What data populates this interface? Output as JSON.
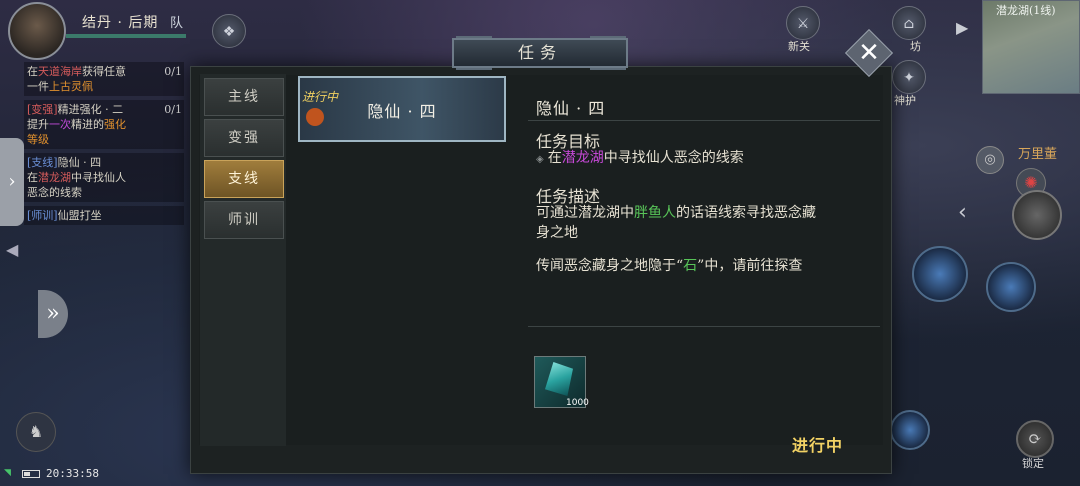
{
  "player": {
    "realm": "结丹 · 后期",
    "team": "队"
  },
  "top_icons": {
    "newbie_label": "新关",
    "workshop_label": "坊",
    "protect_label": "神护"
  },
  "minimap": {
    "title": "潜龙湖(1线)"
  },
  "tracker": {
    "entries": [
      {
        "line1_pre": "在",
        "line1_hl": "天道海岸",
        "line1_post": "获得任意",
        "line2_pre": "一件",
        "line2_hl": "上古灵佩",
        "count": "0/1"
      },
      {
        "tag": "[变强]",
        "title": "精进强化 · 二",
        "line2_pre": "提升",
        "line2_hl1": "一次",
        "line2_mid": "精进的",
        "line2_hl2": "强化",
        "line3": "等级",
        "count": "0/1"
      },
      {
        "tag": "[支线]",
        "title": "隐仙 · 四",
        "line2_pre": "在",
        "line2_hl": "潜龙湖",
        "line2_post": "中寻找仙人",
        "line3": "恶念的线索"
      },
      {
        "tag": "[师训]",
        "title": "仙盟打坐"
      }
    ]
  },
  "status_bar": {
    "time": "20:33:58"
  },
  "hud": {
    "wanli": "万里董",
    "lock": "锁定"
  },
  "dialog": {
    "title": "任务",
    "close": "✕",
    "tabs": [
      {
        "label": "主线",
        "active": false
      },
      {
        "label": "变强",
        "active": false
      },
      {
        "label": "支线",
        "active": true
      },
      {
        "label": "师训",
        "active": false
      }
    ],
    "quest_card": {
      "badge": "进行中",
      "title": "隐仙 · 四"
    },
    "detail": {
      "title": "隐仙 · 四",
      "objective_heading": "任务目标",
      "objective_pre": "在",
      "objective_hl": "潜龙湖",
      "objective_post": "中寻找仙人恶念的线索",
      "desc_heading": "任务描述",
      "desc_line1_pre": "可通过潜龙湖中",
      "desc_line1_hl": "胖鱼人",
      "desc_line1_post": "的话语线索寻找恶念藏",
      "desc_line2": "身之地",
      "desc_para2_pre": "传闻恶念藏身之地隐于“",
      "desc_para2_hl": "石",
      "desc_para2_post": "”中，请前往探查"
    },
    "reward": {
      "quantity": "1000"
    },
    "status": "进行中"
  }
}
